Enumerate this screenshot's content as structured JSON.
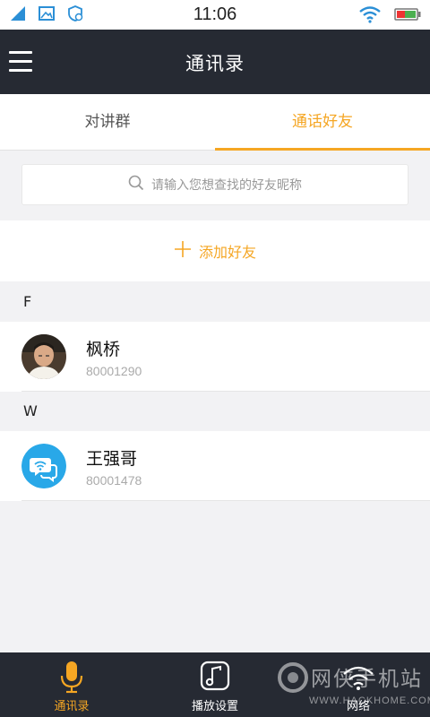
{
  "status_bar": {
    "time": "11:06",
    "left_icons": [
      "signal-icon",
      "image-icon",
      "shield-settings-icon"
    ],
    "right_icons": [
      "wifi-icon",
      "battery-icon"
    ]
  },
  "header": {
    "title": "通讯录",
    "menu_icon": "hamburger-menu-icon"
  },
  "tabs": [
    {
      "label": "对讲群",
      "active": false
    },
    {
      "label": "通话好友",
      "active": true
    }
  ],
  "search": {
    "placeholder": "请输入您想查找的好友昵称",
    "icon": "search-icon"
  },
  "add_friend": {
    "label": "添加好友",
    "icon": "plus-icon"
  },
  "sections": [
    {
      "letter": "F",
      "contacts": [
        {
          "name": "枫桥",
          "id": "80001290",
          "avatar": "photo-avatar"
        }
      ]
    },
    {
      "letter": "W",
      "contacts": [
        {
          "name": "王强哥",
          "id": "80001478",
          "avatar": "chat-wifi-avatar"
        }
      ]
    }
  ],
  "bottom_nav": [
    {
      "label": "通讯录",
      "icon": "microphone-icon",
      "active": true
    },
    {
      "label": "播放设置",
      "icon": "music-note-icon",
      "active": false
    },
    {
      "label": "网络",
      "icon": "wifi-icon",
      "active": false
    }
  ],
  "watermark": {
    "text": "网侠手机站",
    "url": "WWW.HACKHOME.COM"
  },
  "colors": {
    "accent": "#f5a623",
    "header_bg": "#262a33",
    "page_bg": "#f2f2f4",
    "avatar_blue": "#29a8e8"
  }
}
